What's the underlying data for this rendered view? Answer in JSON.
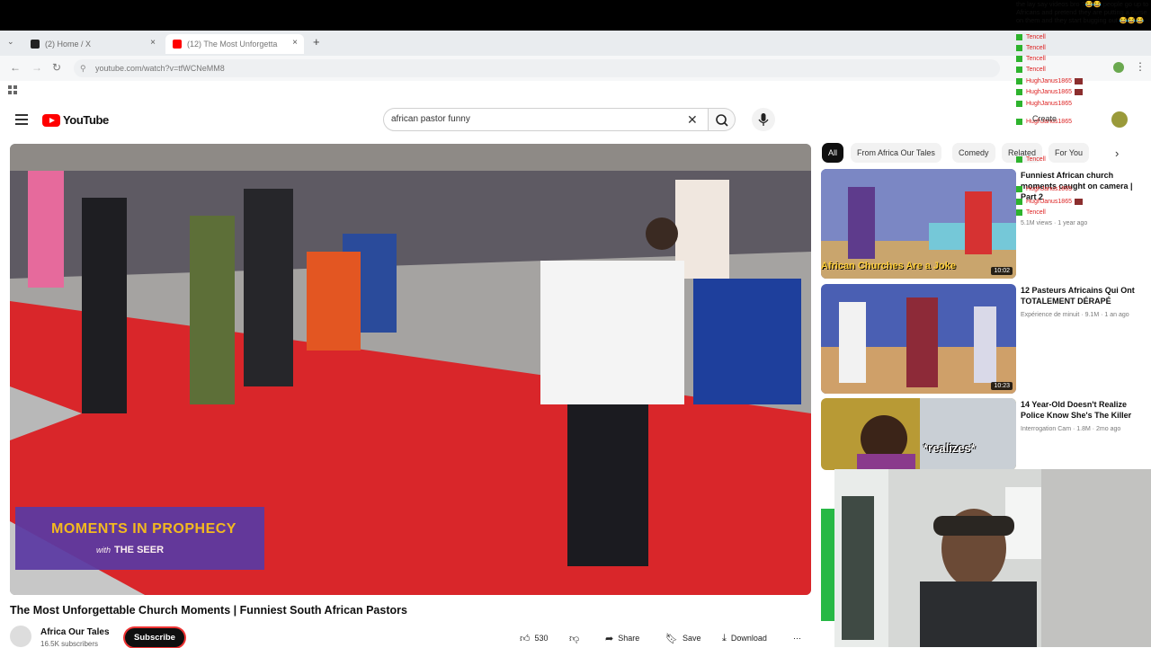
{
  "browser": {
    "tabs": [
      {
        "label": "(2) Home / X",
        "icon": "x-logo-icon"
      },
      {
        "label": "(12) The Most Unforgetta",
        "icon": "youtube-icon",
        "active": true
      }
    ],
    "new_tab_symbol": "+",
    "url": "youtube.com/watch?v=tfWCNeMM8"
  },
  "youtube": {
    "logo_text": "YouTube",
    "search_value": "african pastor funny",
    "chips": [
      "All",
      "From Africa Our Tales",
      "Comedy",
      "Related",
      "For You"
    ],
    "create_label": "Create"
  },
  "video": {
    "overlay_line1": "MOMENTS IN PROPHECY",
    "overlay_line2_prefix": "with",
    "overlay_line2": "THE SEER",
    "title": "The Most Unforgettable Church Moments | Funniest South African Pastors",
    "channel": "Africa Our Tales",
    "subscribers": "16.5K subscribers",
    "subscribe_label": "Subscribe",
    "likes": "530",
    "share_label": "Share",
    "save_label": "Save",
    "download_label": "Download",
    "more_symbol": "⋯"
  },
  "sidebar": {
    "videos": [
      {
        "thumb_text": "African Churches Are a Joke",
        "duration": "10:02",
        "title": "Funniest African church moments caught on camera | Part 2",
        "meta": "5.1M views · 1 year ago"
      },
      {
        "thumb_text": "",
        "duration": "10:23",
        "title": "12 Pasteurs Africains Qui Ont TOTALEMENT DÉRAPÉ",
        "meta": "Expérience de minuit · 9.1M · 1 an ago"
      },
      {
        "thumb_text": "*realizes*",
        "duration": "",
        "title": "14 Year-Old Doesn't Realize Police Know She's The Killer",
        "meta": "Interrogation Cam · 1.8M · 2mo ago"
      }
    ]
  },
  "chat": {
    "top_message": "the lay say videos bro ?😂😂 people go up to Africans and pretend they are putting a curse on them and they start bugging out 😂😂😂",
    "names": [
      "Tencell",
      "Tencell",
      "Tencell",
      "Tencell",
      "HughJanus1865",
      "HughJanus1865",
      "HughJanus1865",
      "HughJanus1865",
      "Tencell",
      "HughJanus1865",
      "HughJanus1865",
      "Tencell"
    ]
  },
  "colors": {
    "brand_red": "#ff0000",
    "chat_name": "#dd2222",
    "chat_badge": "#2db32d",
    "overlay_purple": "#5b3aa3",
    "overlay_gold": "#f6c51f"
  }
}
